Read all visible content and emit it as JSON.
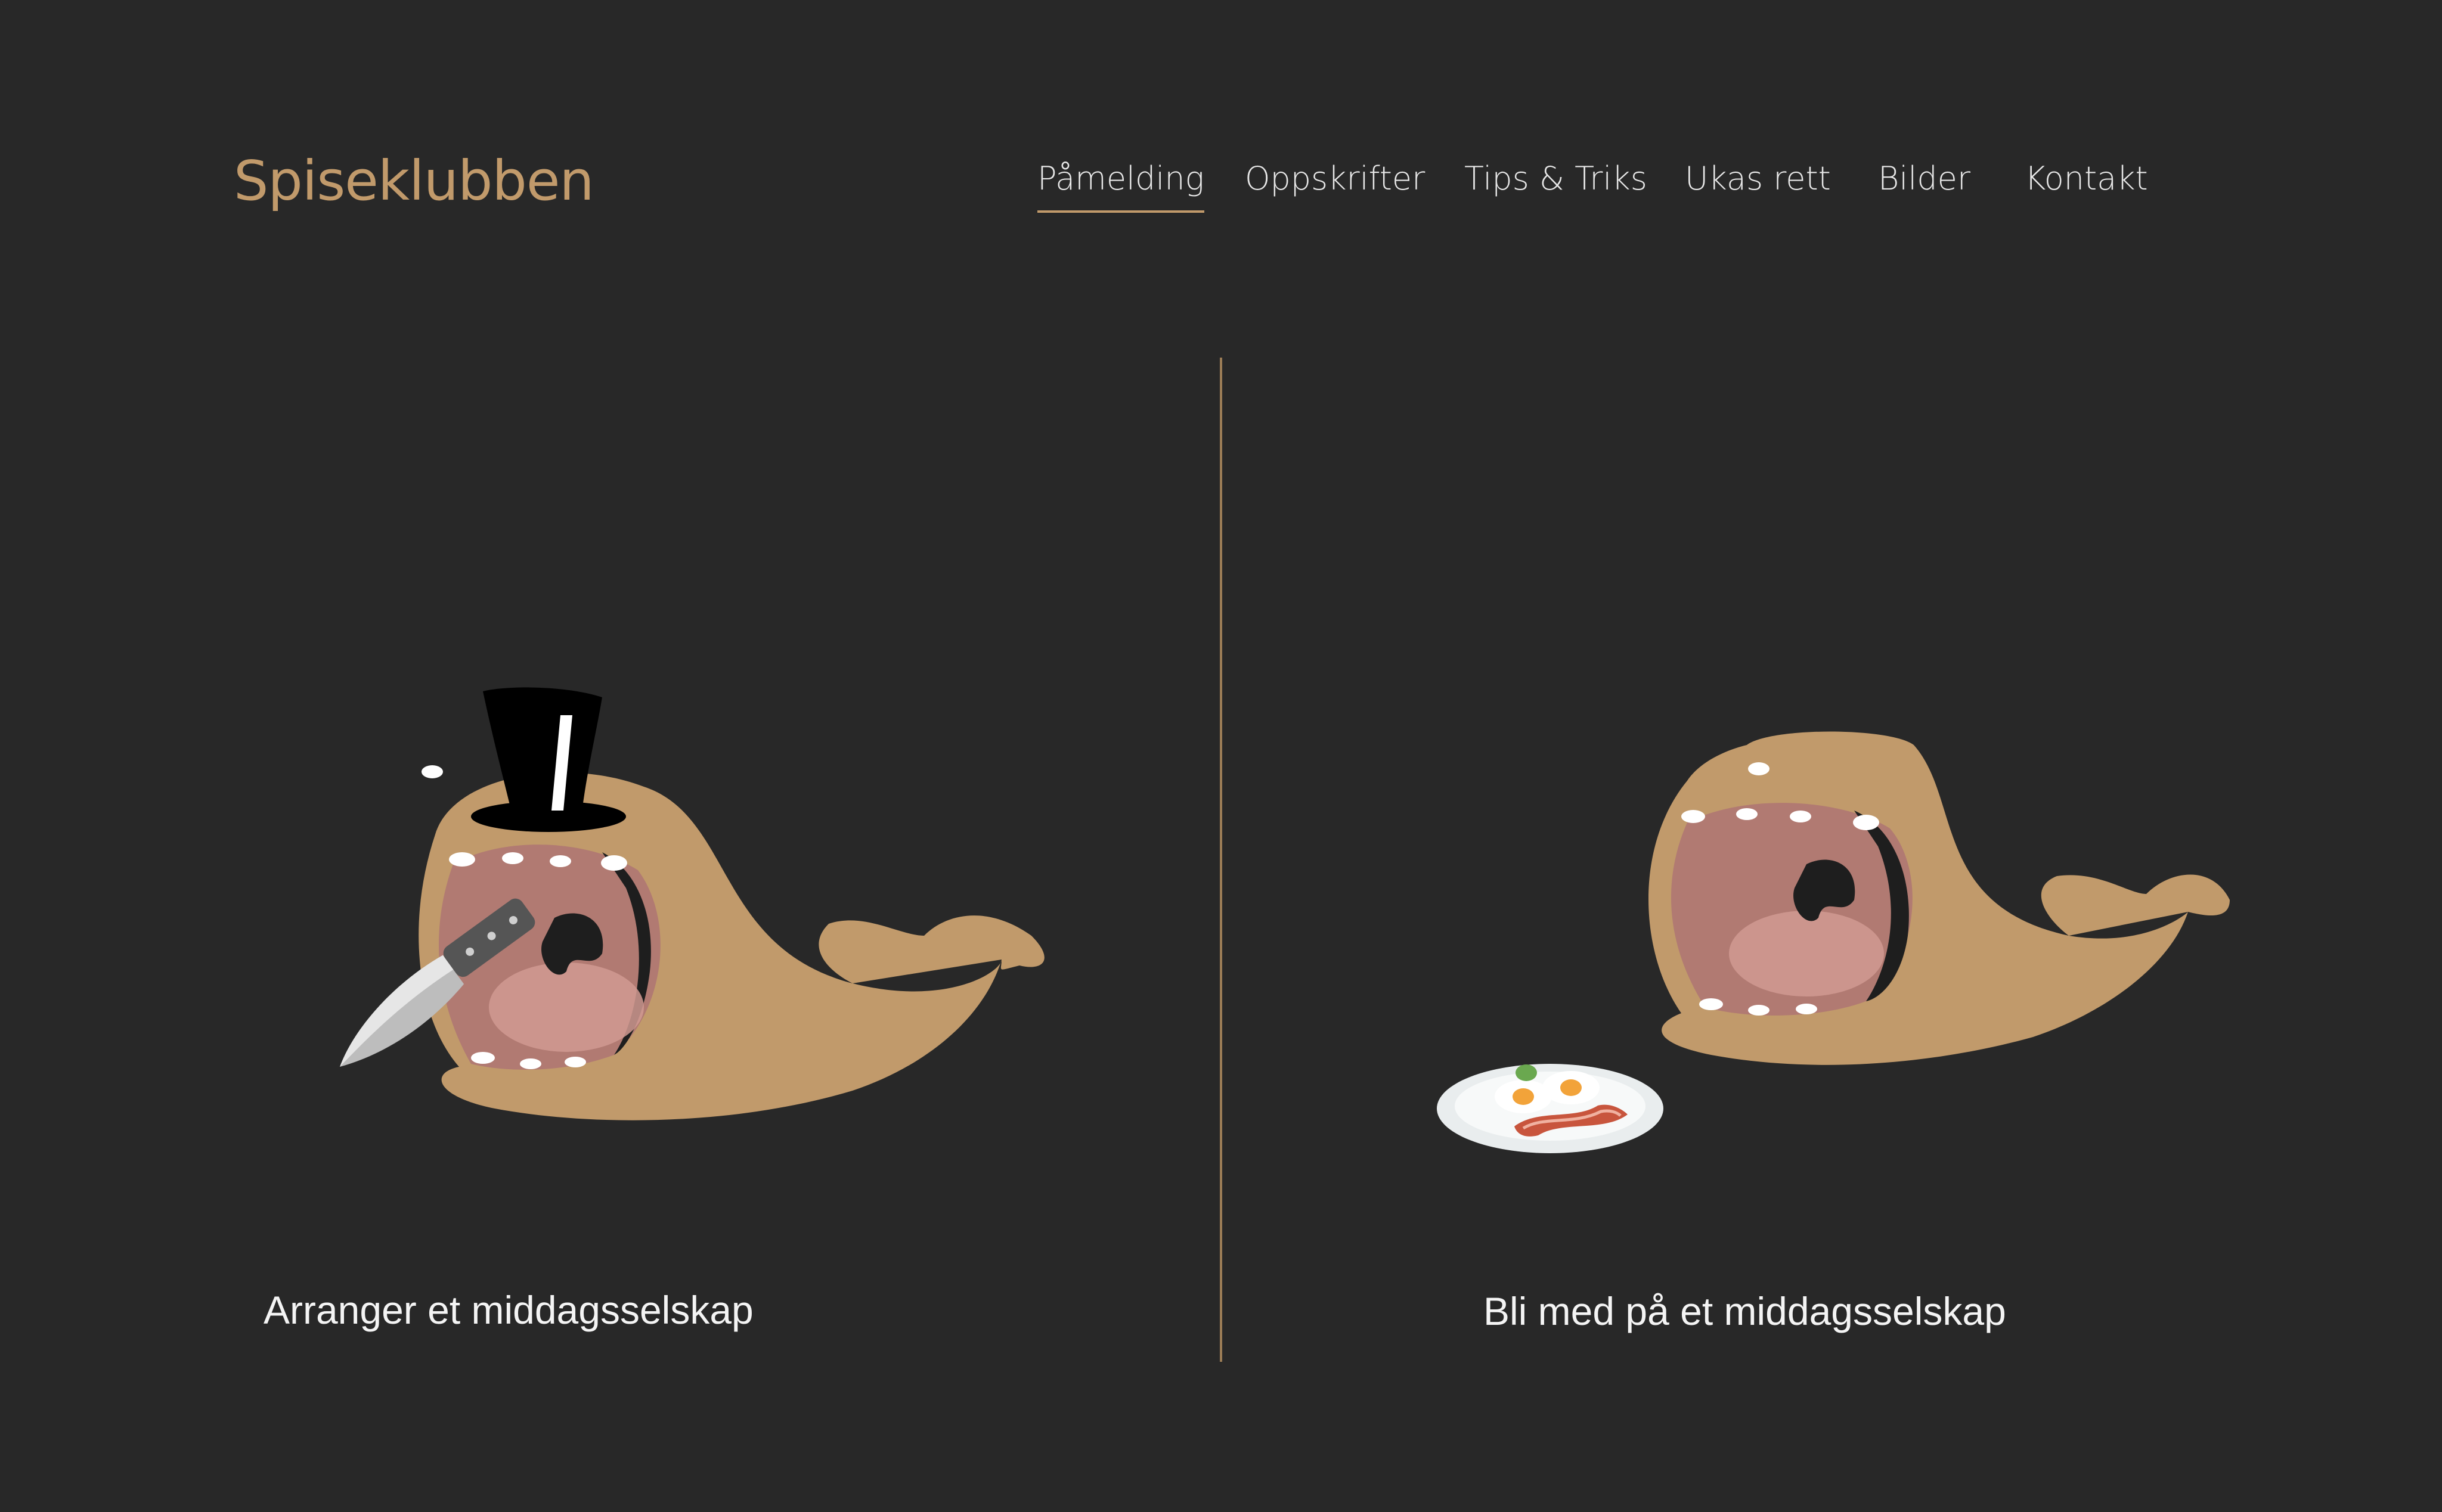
{
  "header": {
    "logo": "Spiseklubben"
  },
  "nav": {
    "items": [
      {
        "label": "Påmelding",
        "active": true
      },
      {
        "label": "Oppskrifter",
        "active": false
      },
      {
        "label": "Tips & Triks",
        "active": false
      },
      {
        "label": "Ukas rett",
        "active": false
      },
      {
        "label": "Bilder",
        "active": false
      },
      {
        "label": "Kontakt",
        "active": false
      }
    ]
  },
  "options": [
    {
      "caption": "Arranger et middagsselskap",
      "icon": "whale-with-top-hat-and-knife"
    },
    {
      "caption": "Bli med på et middagsselskap",
      "icon": "whale-with-breakfast-plate"
    }
  ],
  "colors": {
    "background": "#282828",
    "accent": "#c19a6b",
    "whale": "#c19a6b",
    "mouth": "#b17a72",
    "text": "#f4f4f4"
  }
}
